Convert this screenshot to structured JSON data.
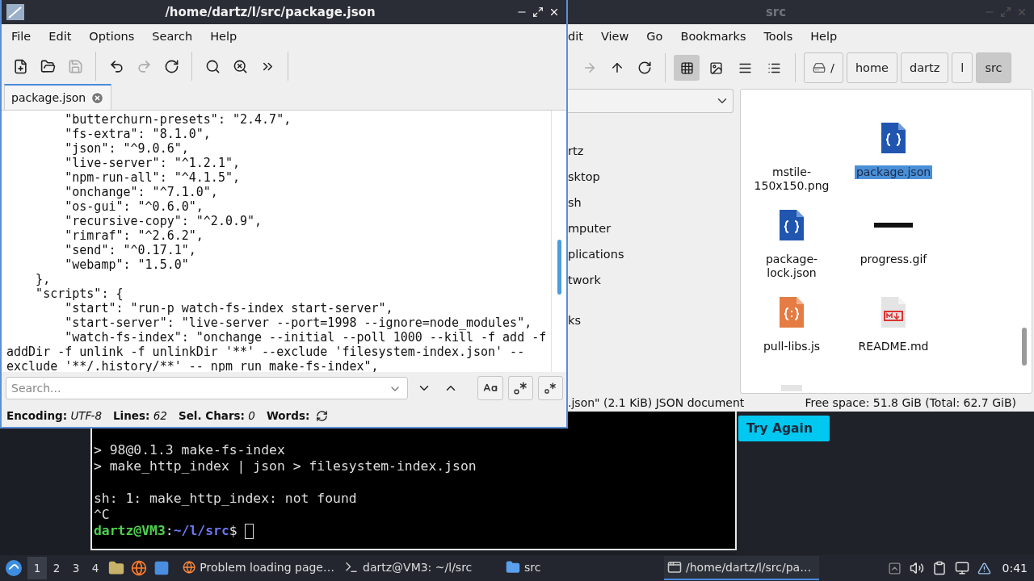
{
  "editor": {
    "title": "/home/dartz/l/src/package.json",
    "menu": [
      "File",
      "Edit",
      "Options",
      "Search",
      "Help"
    ],
    "tab": {
      "label": "package.json"
    },
    "code_lines": [
      "        \"butterchurn-presets\": \"2.4.7\",",
      "        \"fs-extra\": \"8.1.0\",",
      "        \"json\": \"^9.0.6\",",
      "        \"live-server\": \"^1.2.1\",",
      "        \"npm-run-all\": \"^4.1.5\",",
      "        \"onchange\": \"^7.1.0\",",
      "        \"os-gui\": \"^0.6.0\",",
      "        \"recursive-copy\": \"^2.0.9\",",
      "        \"rimraf\": \"^2.6.2\",",
      "        \"send\": \"^0.17.1\",",
      "        \"webamp\": \"1.5.0\"",
      "    },",
      "    \"scripts\": {",
      "        \"start\": \"run-p watch-fs-index start-server\",",
      "        \"start-server\": \"live-server --port=1998 --ignore=node_modules\",",
      "        \"watch-fs-index\": \"onchange --initial --poll 1000 --kill -f add -f",
      "addDir -f unlink -f unlinkDir '**' --exclude 'filesystem-index.json' --",
      "exclude '**/.history/**' -- npm run make-fs-index\","
    ],
    "search": {
      "placeholder": "Search..."
    },
    "status": [
      {
        "label": "Encoding:",
        "value": "UTF-8"
      },
      {
        "label": "Lines:",
        "value": "62"
      },
      {
        "label": "Sel. Chars:",
        "value": "0"
      },
      {
        "label": "Words:"
      }
    ]
  },
  "file_manager": {
    "title": "src",
    "menu": [
      "dit",
      "View",
      "Go",
      "Bookmarks",
      "Tools",
      "Help"
    ],
    "view_modes": [
      {
        "kind": "icons",
        "selected": true
      },
      {
        "kind": "thumbnails",
        "selected": false
      },
      {
        "kind": "compact",
        "selected": false
      },
      {
        "kind": "list",
        "selected": false
      }
    ],
    "path": [
      {
        "label": "/",
        "kind": "root",
        "selected": false
      },
      {
        "label": "home",
        "kind": "dir",
        "selected": false
      },
      {
        "label": "dartz",
        "kind": "dir",
        "selected": false
      },
      {
        "label": "l",
        "kind": "dir",
        "selected": false
      },
      {
        "label": "src",
        "kind": "dir",
        "selected": true
      }
    ],
    "place_groups": [
      [
        "rtz",
        "sktop",
        "sh",
        "mputer",
        "plications",
        "twork"
      ],
      [
        "ks"
      ]
    ],
    "files": [
      {
        "name": "mstile-150x150.png",
        "kind": "none",
        "selected": false
      },
      {
        "name": "package.json",
        "kind": "json",
        "selected": true
      },
      {
        "name": "package-lock.json",
        "kind": "json",
        "selected": false
      },
      {
        "name": "progress.gif",
        "kind": "bar",
        "selected": false
      },
      {
        "name": "pull-libs.js",
        "kind": "js",
        "selected": false
      },
      {
        "name": "README.md",
        "kind": "markdown",
        "selected": false
      },
      {
        "kind": "partial",
        "selected": false
      }
    ],
    "status_left": ".json\" (2.1 KiB) JSON document",
    "status_right": "Free space: 51.8 GiB (Total: 62.7 GiB)"
  },
  "terminal": {
    "blocks": [
      [
        "> 98@0.1.3 make-fs-index",
        "> make_http_index | json > filesystem-index.json"
      ],
      [
        "sh: 1: make_http_index: not found",
        "^C"
      ]
    ],
    "prompt": {
      "user": "dartz@VM3",
      "separator": ":",
      "path": "~/l/src",
      "symbol": "$"
    }
  },
  "browser": {
    "button": "Try Again"
  },
  "taskbar": {
    "workspaces": [
      {
        "label": "1",
        "selected": true
      },
      {
        "label": "2",
        "selected": false
      },
      {
        "label": "3",
        "selected": false
      },
      {
        "label": "4",
        "selected": false
      }
    ],
    "tasks": [
      {
        "label": "Problem loading page…",
        "kind": "browser",
        "selected": false
      },
      {
        "label": "dartz@VM3: ~/l/src",
        "kind": "terminal",
        "selected": false
      },
      {
        "label": "src",
        "kind": "folder",
        "selected": false
      },
      {
        "label": "/home/dartz/l/src/pa…",
        "kind": "editor",
        "selected": true
      }
    ],
    "clock": "0:41"
  }
}
